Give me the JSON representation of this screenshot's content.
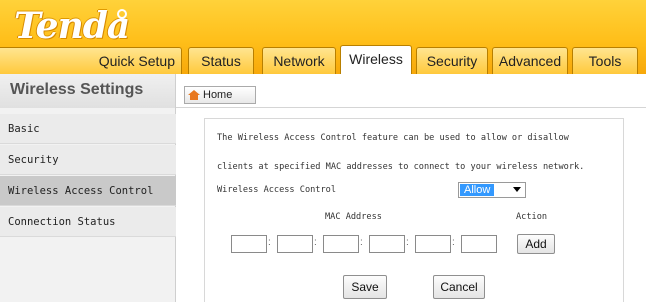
{
  "brand": {
    "logo_text": "Tenda"
  },
  "tabs": [
    {
      "label": "Quick Setup"
    },
    {
      "label": "Status"
    },
    {
      "label": "Network"
    },
    {
      "label": "Wireless"
    },
    {
      "label": "Security"
    },
    {
      "label": "Advanced"
    },
    {
      "label": "Tools"
    }
  ],
  "active_tab": "Wireless",
  "section_title": "Wireless Settings",
  "home_button": "Home",
  "sidebar": {
    "items": [
      {
        "label": "Basic"
      },
      {
        "label": "Security"
      },
      {
        "label": "Wireless Access Control"
      },
      {
        "label": "Connection Status"
      }
    ],
    "active": "Wireless Access Control"
  },
  "content": {
    "description_line1": "The Wireless Access Control feature can be used to allow or disallow",
    "description_line2": "clients at specified MAC addresses to connect to your wireless network.",
    "wac_label": "Wireless Access Control",
    "wac_value": "Allow",
    "mac_address_header": "MAC Address",
    "action_header": "Action",
    "add_button": "Add",
    "save_button": "Save",
    "cancel_button": "Cancel"
  },
  "colors": {
    "header_yellow": "#ffc93c",
    "select_highlight": "#3399ff",
    "active_sidebar": "#c9c9c9"
  },
  "icons": {
    "home": "home-icon",
    "dropdown": "chevron-down-icon"
  }
}
